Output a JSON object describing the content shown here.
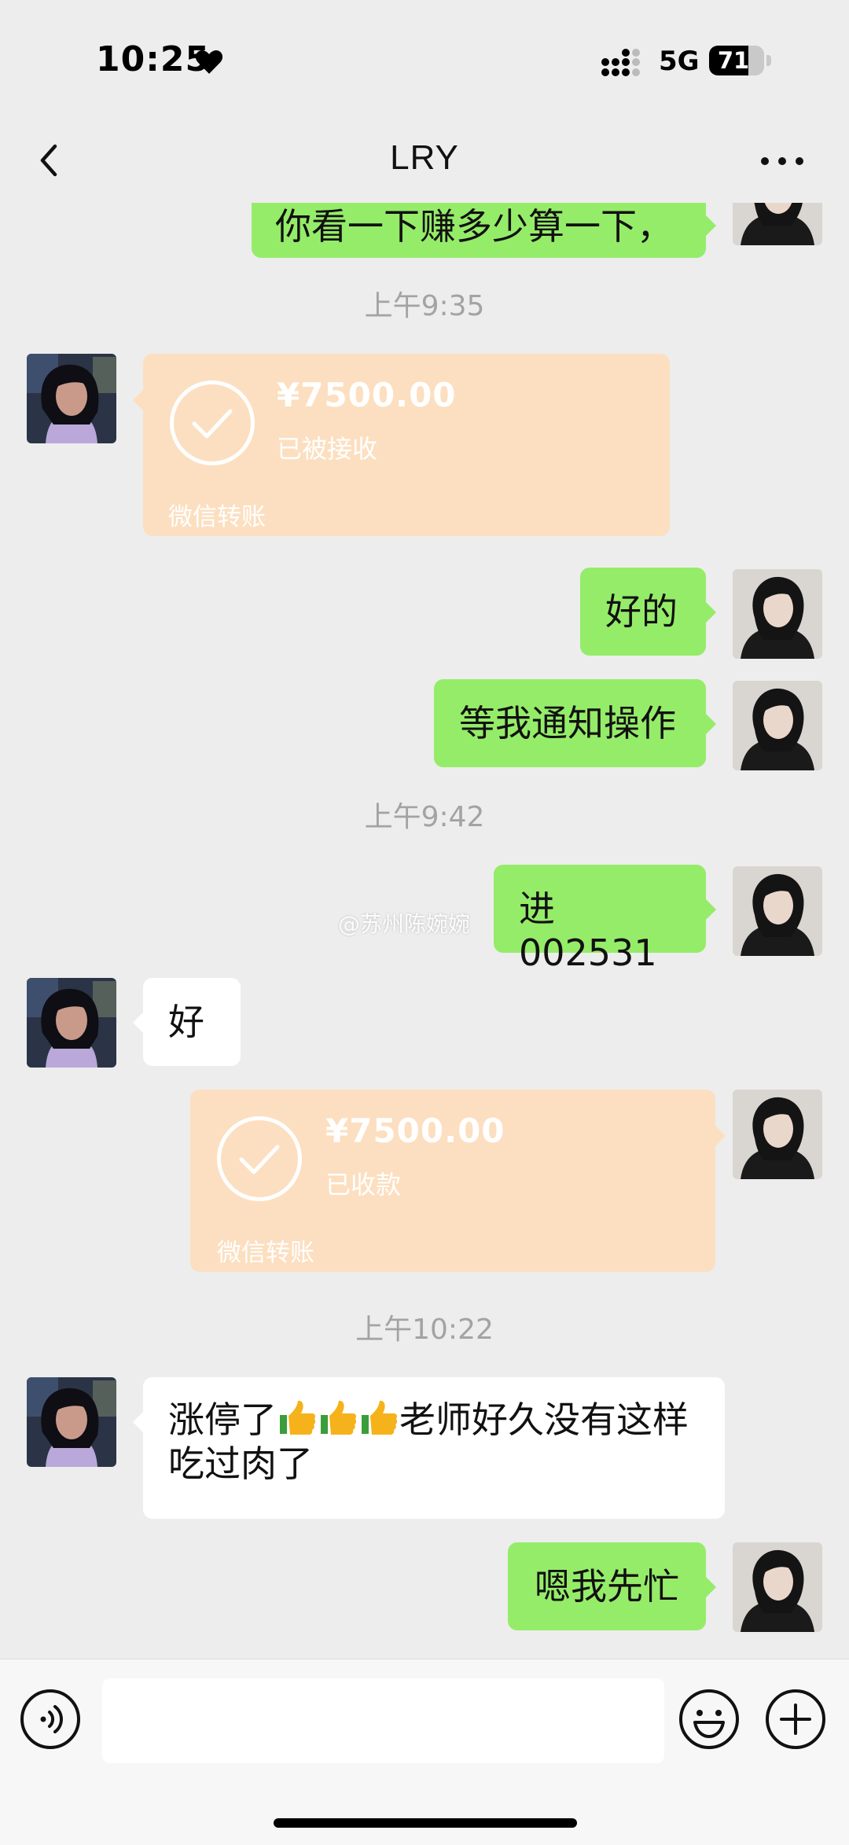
{
  "status_bar": {
    "time": "10:25",
    "network": "5G",
    "battery": "71",
    "battery_level": 0.71
  },
  "header": {
    "title": "LRY"
  },
  "messages": {
    "m0": {
      "text": "你看一下赚多少算一下，"
    },
    "t1": {
      "text": "上午9:35"
    },
    "m1": {
      "amount": "¥7500.00",
      "status": "已被接收",
      "label": "微信转账"
    },
    "m2": {
      "text": "好的"
    },
    "m3": {
      "text": "等我通知操作"
    },
    "t2": {
      "text": "上午9:42"
    },
    "m4": {
      "text": "进002531"
    },
    "m5": {
      "text": "好"
    },
    "m6": {
      "amount": "¥7500.00",
      "status": "已收款",
      "label": "微信转账"
    },
    "t3": {
      "text": "上午10:22"
    },
    "m7": {
      "line1_prefix": "涨停了",
      "line1_suffix": "老师好久没有这样",
      "line2": "吃过肉了"
    },
    "m8": {
      "text": "嗯我先忙"
    }
  },
  "watermark": "@苏州陈婉婉",
  "input": {
    "value": "",
    "placeholder": ""
  },
  "colors": {
    "background": "#ededed",
    "sent_bubble": "#95ec69",
    "received_bubble": "#ffffff",
    "transfer_card": "#fcdfc0"
  },
  "icons": [
    "heart-icon",
    "signal-icon",
    "battery-icon",
    "back-icon",
    "more-icon",
    "check-icon",
    "thumbs-up-icon",
    "voice-icon",
    "emoji-icon",
    "plus-icon"
  ]
}
